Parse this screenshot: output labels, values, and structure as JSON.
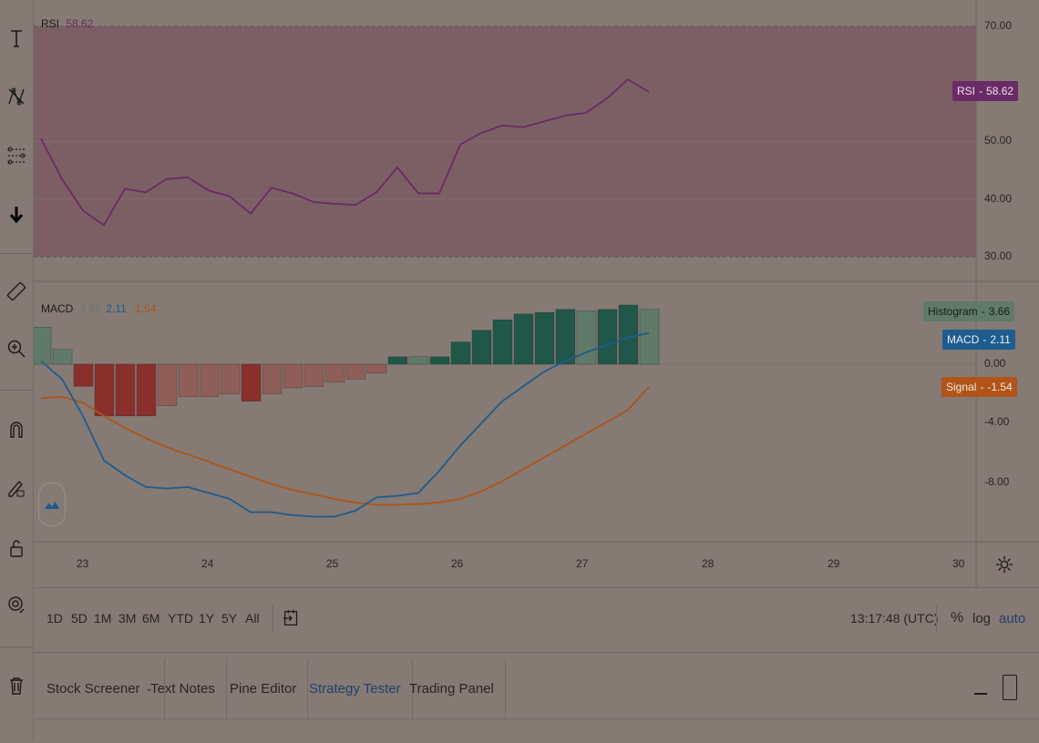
{
  "rsi": {
    "legend_label": "RSI",
    "legend_value": "58.62",
    "tag": "RSI",
    "tag_value": "58.62",
    "color": "#6a2a66",
    "axis_labels": [
      "70.00",
      "50.00",
      "40.00",
      "30.00"
    ],
    "upper_band": 70,
    "lower_band": 30,
    "values": [
      50.5,
      43.5,
      38,
      35.5,
      41.8,
      41.2,
      43.5,
      43.8,
      41.5,
      40.5,
      37.5,
      42,
      41,
      39.5,
      39.2,
      39,
      41.2,
      45.5,
      41,
      41,
      49.5,
      51.5,
      52.8,
      52.5,
      53.5,
      54.5,
      55,
      57.5,
      60.8,
      58.6
    ]
  },
  "macd": {
    "legend_label": "MACD",
    "legend_values": [
      "3.66",
      "2.11",
      "-1.54"
    ],
    "tags": [
      {
        "label": "Histogram",
        "value": "3.66",
        "color": "#5f7a68",
        "text": "#1e1a17"
      },
      {
        "label": "MACD",
        "value": "2.11",
        "color": "#1e5c8e",
        "text": "#e6edf5"
      },
      {
        "label": "Signal",
        "value": "-1.54",
        "color": "#b05418",
        "text": "#f5e8dd"
      }
    ],
    "axis_labels": [
      "0.00",
      "-4.00",
      "-8.00"
    ],
    "histogram": [
      2.5,
      1.0,
      -1.5,
      -3.5,
      -3.5,
      -3.5,
      -2.8,
      -2.2,
      -2.2,
      -2.0,
      -2.5,
      -2.0,
      -1.6,
      -1.5,
      -1.2,
      -1.0,
      -0.6,
      0.5,
      0.5,
      0.5,
      1.5,
      2.3,
      3.0,
      3.4,
      3.5,
      3.7,
      3.6,
      3.7,
      4.0,
      3.7
    ],
    "histogram_colors": [
      "#5f7a68",
      "#5f7a68",
      "#8a2f2c",
      "#8a2f2c",
      "#8a2f2c",
      "#8a2f2c",
      "#8f5e58",
      "#8f5e58",
      "#8f5e58",
      "#8f5e58",
      "#8a2f2c",
      "#8f5e58",
      "#8f5e58",
      "#8f5e58",
      "#8f5e58",
      "#8f5e58",
      "#8f5e58",
      "#1f5749",
      "#5f7a68",
      "#1f5749",
      "#1f5749",
      "#1f5749",
      "#1f5749",
      "#1f5749",
      "#1f5749",
      "#1f5749",
      "#5f7a68",
      "#1f5749",
      "#1f5749",
      "#5f7a68"
    ],
    "macd_line": [
      0.2,
      -1.0,
      -3.5,
      -6.5,
      -7.5,
      -8.3,
      -8.4,
      -8.3,
      -8.7,
      -9.1,
      -10.0,
      -10.0,
      -10.2,
      -10.3,
      -10.3,
      -9.9,
      -9.0,
      -8.9,
      -8.7,
      -7.2,
      -5.5,
      -4.0,
      -2.5,
      -1.5,
      -0.5,
      0.2,
      0.8,
      1.3,
      1.8,
      2.11
    ],
    "signal_line": [
      -2.3,
      -2.2,
      -2.6,
      -3.5,
      -4.3,
      -5.0,
      -5.6,
      -6.1,
      -6.6,
      -7.1,
      -7.6,
      -8.1,
      -8.5,
      -8.8,
      -9.1,
      -9.35,
      -9.5,
      -9.5,
      -9.45,
      -9.35,
      -9.1,
      -8.6,
      -7.9,
      -7.1,
      -6.3,
      -5.5,
      -4.7,
      -3.9,
      -3.1,
      -1.54
    ],
    "macd_color": "#1e5c8e",
    "signal_color": "#b05418"
  },
  "x_axis": {
    "ticks": [
      "23",
      "24",
      "25",
      "26",
      "27",
      "28",
      "29",
      "30"
    ]
  },
  "gear_icon": "gear-icon",
  "logo_icon": "tradingview-logo-icon",
  "time_ranges": [
    "1D",
    "5D",
    "1M",
    "3M",
    "6M",
    "YTD",
    "1Y",
    "5Y",
    "All"
  ],
  "clock": "13:17:48 (UTC)",
  "scale_options": {
    "percent": "%",
    "log": "log",
    "auto": "auto"
  },
  "bottom_tabs": [
    "Stock Screener",
    "Text Notes",
    "Pine Editor",
    "Strategy Tester",
    "Trading Panel"
  ],
  "active_tab": "Strategy Tester",
  "colors": {
    "background": "#857a74",
    "rsi_band": "#7c5f65",
    "accent": "#24406e"
  }
}
